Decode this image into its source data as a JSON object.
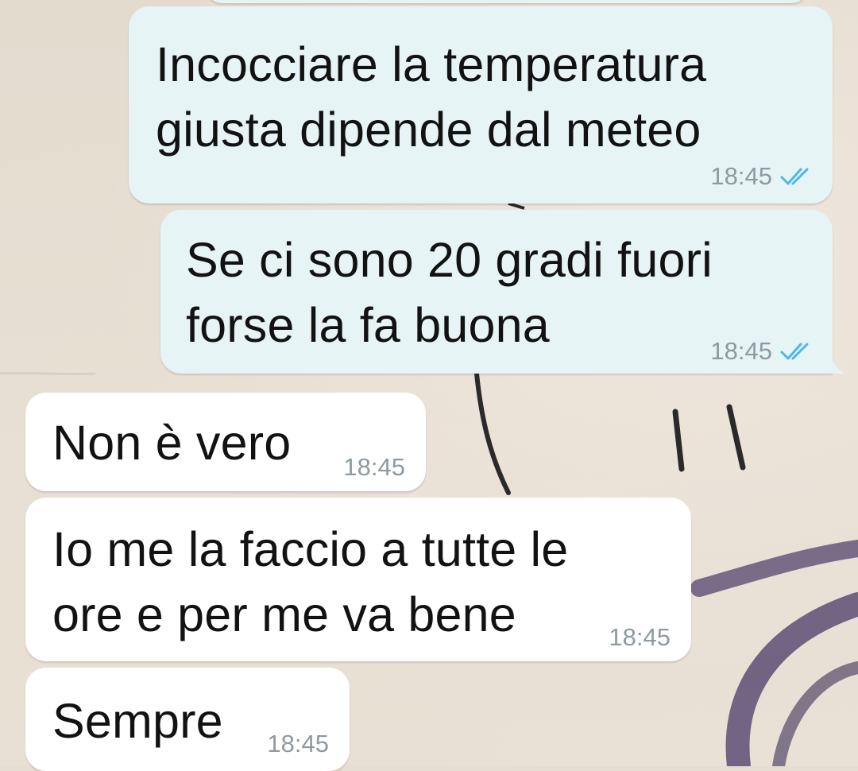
{
  "chat": {
    "messages": [
      {
        "direction": "outgoing",
        "text": "Incocciare la temperatura\ngiusta dipende dal meteo",
        "time": "18:45",
        "status_icon": "double-check-read-icon"
      },
      {
        "direction": "outgoing",
        "text": "Se ci sono 20 gradi fuori\nforse la fa buona",
        "time": "18:45",
        "status_icon": "double-check-read-icon"
      },
      {
        "direction": "incoming",
        "text": "Non è vero",
        "time": "18:45"
      },
      {
        "direction": "incoming",
        "text": "Io me la faccio a tutte le\nore e per me va bene",
        "time": "18:45"
      },
      {
        "direction": "incoming",
        "text": "Sempre",
        "time": "18:45"
      }
    ]
  },
  "colors": {
    "outgoing_bubble": "#e6f4f5",
    "incoming_bubble": "#ffffff",
    "read_ticks": "#4fb6ec",
    "timestamp": "#8e9aa0",
    "wallpaper": "#e6ddd2"
  }
}
